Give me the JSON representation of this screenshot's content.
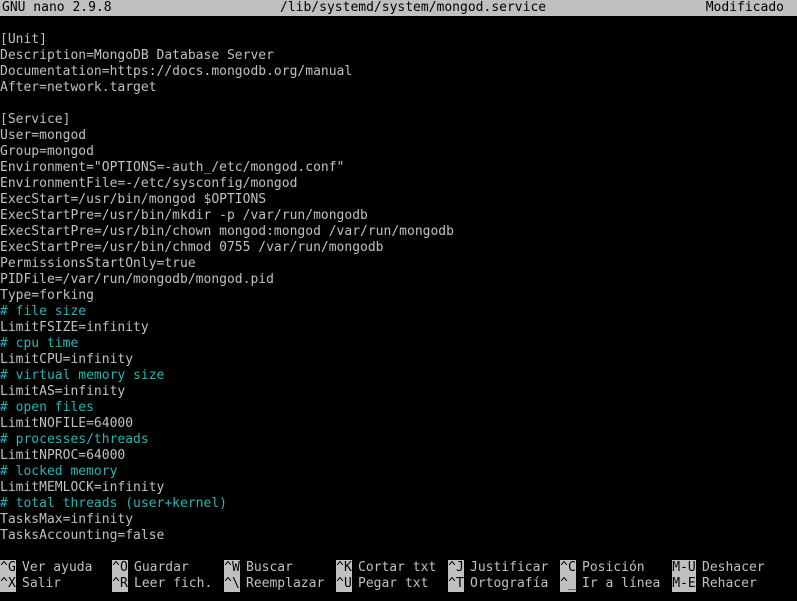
{
  "titlebar": {
    "app": "GNU nano 2.9.8",
    "file": "/lib/systemd/system/mongod.service",
    "status": "Modificado"
  },
  "editor": {
    "lines": [
      {
        "text": "[Unit]",
        "kind": "normal"
      },
      {
        "text": "Description=MongoDB Database Server",
        "kind": "normal"
      },
      {
        "text": "Documentation=https://docs.mongodb.org/manual",
        "kind": "normal"
      },
      {
        "text": "After=network.target",
        "kind": "normal"
      },
      {
        "text": "",
        "kind": "normal"
      },
      {
        "text": "[Service]",
        "kind": "normal"
      },
      {
        "text": "User=mongod",
        "kind": "normal"
      },
      {
        "text": "Group=mongod",
        "kind": "normal"
      },
      {
        "text": "Environment=\"OPTIONS=-auth_/etc/mongod.conf\"",
        "kind": "normal"
      },
      {
        "text": "EnvironmentFile=-/etc/sysconfig/mongod",
        "kind": "normal"
      },
      {
        "text": "ExecStart=/usr/bin/mongod $OPTIONS",
        "kind": "normal"
      },
      {
        "text": "ExecStartPre=/usr/bin/mkdir -p /var/run/mongodb",
        "kind": "normal"
      },
      {
        "text": "ExecStartPre=/usr/bin/chown mongod:mongod /var/run/mongodb",
        "kind": "normal"
      },
      {
        "text": "ExecStartPre=/usr/bin/chmod 0755 /var/run/mongodb",
        "kind": "normal"
      },
      {
        "text": "PermissionsStartOnly=true",
        "kind": "normal"
      },
      {
        "text": "PIDFile=/var/run/mongodb/mongod.pid",
        "kind": "normal"
      },
      {
        "text": "Type=forking",
        "kind": "normal"
      },
      {
        "text": "# file size",
        "kind": "comment"
      },
      {
        "text": "LimitFSIZE=infinity",
        "kind": "normal"
      },
      {
        "text": "# cpu time",
        "kind": "comment"
      },
      {
        "text": "LimitCPU=infinity",
        "kind": "normal"
      },
      {
        "text": "# virtual memory size",
        "kind": "comment"
      },
      {
        "text": "LimitAS=infinity",
        "kind": "normal"
      },
      {
        "text": "# open files",
        "kind": "comment"
      },
      {
        "text": "LimitNOFILE=64000",
        "kind": "normal"
      },
      {
        "text": "# processes/threads",
        "kind": "comment"
      },
      {
        "text": "LimitNPROC=64000",
        "kind": "normal"
      },
      {
        "text": "# locked memory",
        "kind": "comment"
      },
      {
        "text": "LimitMEMLOCK=infinity",
        "kind": "normal"
      },
      {
        "text": "# total threads (user+kernel)",
        "kind": "comment"
      },
      {
        "text": "TasksMax=infinity",
        "kind": "normal"
      },
      {
        "text": "TasksAccounting=false",
        "kind": "normal"
      }
    ]
  },
  "shortcuts": [
    {
      "key": "^G",
      "label": "Ver ayuda"
    },
    {
      "key": "^O",
      "label": "Guardar"
    },
    {
      "key": "^W",
      "label": "Buscar"
    },
    {
      "key": "^K",
      "label": "Cortar txt"
    },
    {
      "key": "^J",
      "label": "Justificar"
    },
    {
      "key": "^C",
      "label": "Posición"
    },
    {
      "key": "M-U",
      "label": "Deshacer"
    },
    {
      "key": "^X",
      "label": "Salir"
    },
    {
      "key": "^R",
      "label": "Leer fich."
    },
    {
      "key": "^\\",
      "label": "Reemplazar"
    },
    {
      "key": "^U",
      "label": "Pegar txt"
    },
    {
      "key": "^T",
      "label": "Ortografía"
    },
    {
      "key": "^_",
      "label": "Ir a línea"
    },
    {
      "key": "M-E",
      "label": "Rehacer"
    }
  ],
  "colors": {
    "background": "#000000",
    "text": "#c0c0c0",
    "comment": "#28b3b3",
    "bar": "#c0c0c0"
  }
}
